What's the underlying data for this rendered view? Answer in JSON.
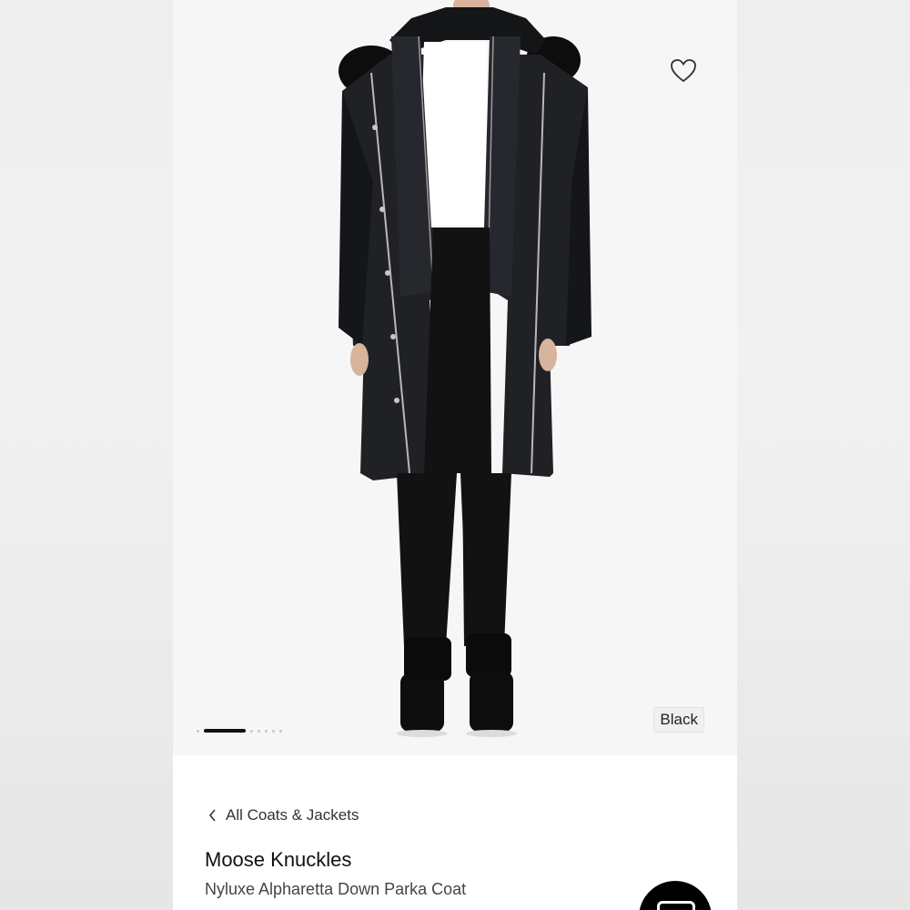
{
  "product_image": {
    "wishlist_icon": "heart-outline-icon",
    "carousel": {
      "total_slides": 7,
      "active_index": 0
    },
    "color_label": "Black"
  },
  "breadcrumb": {
    "icon": "chevron-left-icon",
    "label": "All Coats & Jackets"
  },
  "product": {
    "brand": "Moose Knuckles",
    "name": "Nyluxe Alpharetta Down Parka Coat"
  },
  "colors": {
    "accent": "#111111",
    "image_bg": "#f6f6f6",
    "coat": "#1c1e22"
  }
}
